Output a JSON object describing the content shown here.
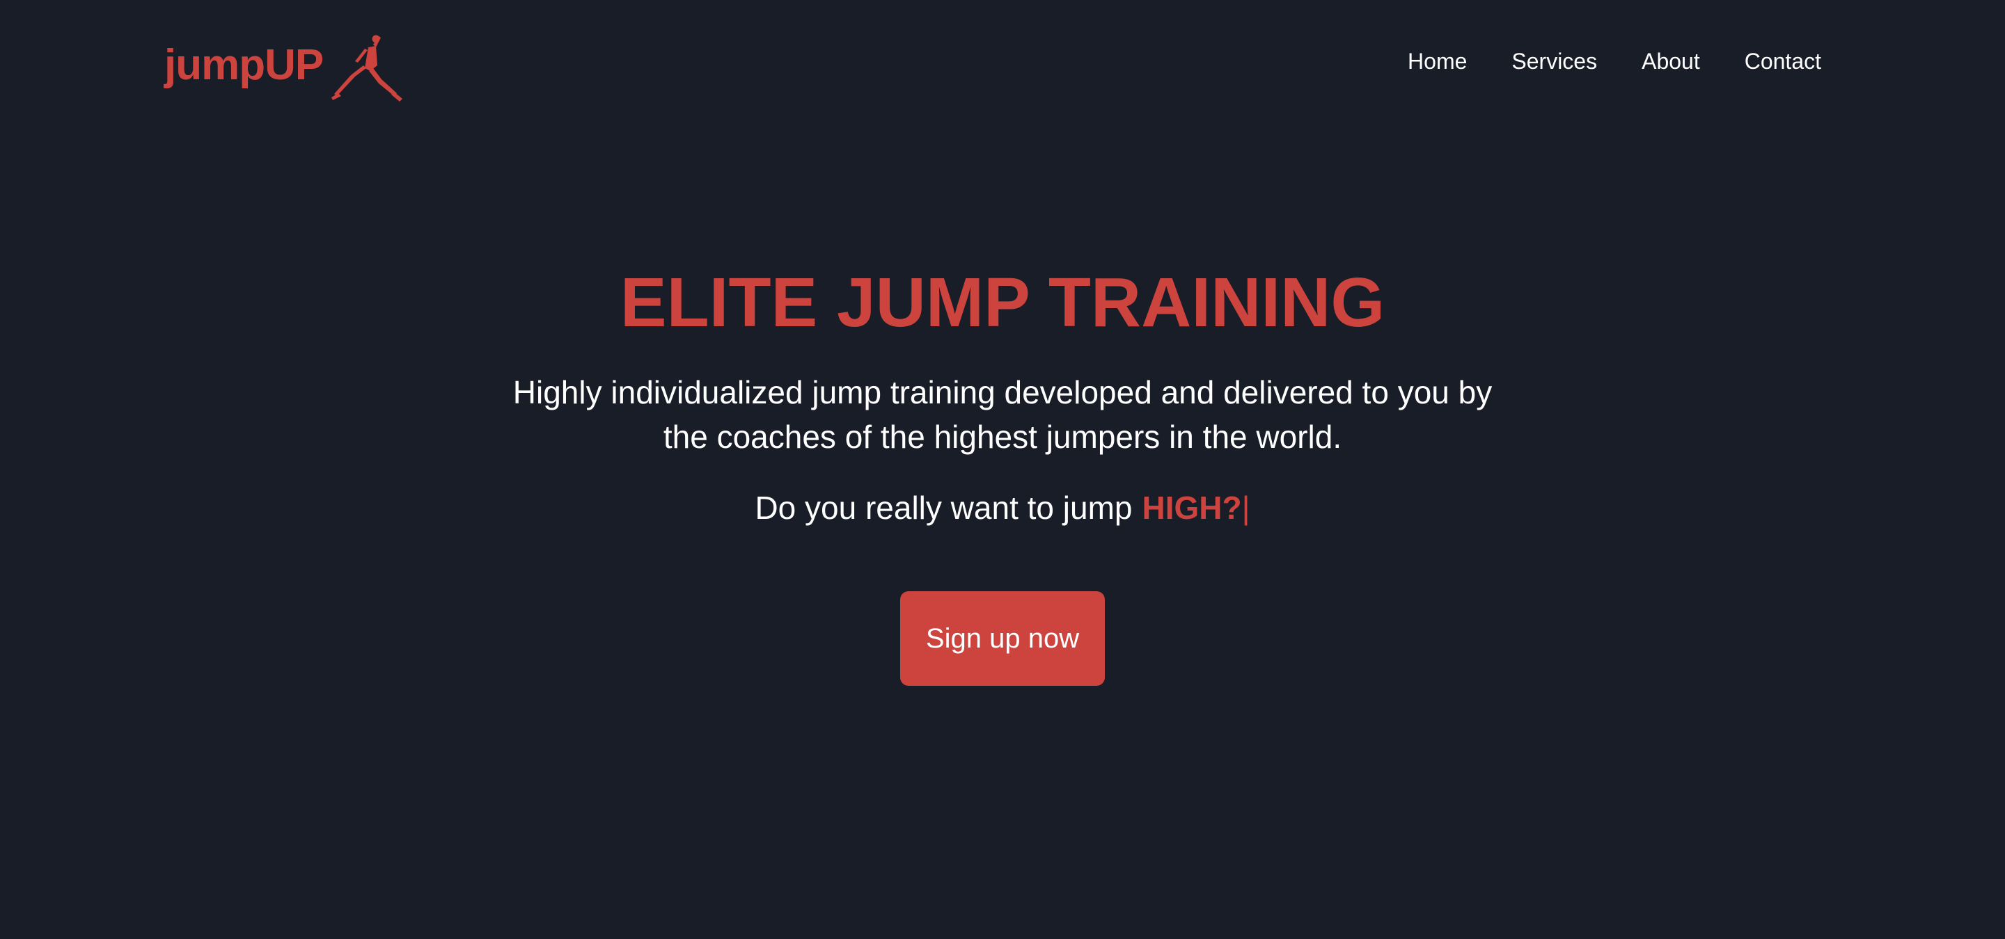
{
  "navbar": {
    "brand_text": "jumpUP",
    "brand_logo_icon": "jumpman-icon",
    "links": [
      "Home",
      "Services",
      "About",
      "Contact"
    ]
  },
  "hero": {
    "title": "ELITE JUMP TRAINING",
    "subtitle": "Highly individualized jump training developed and delivered to you by the coaches of the highest jumpers in the world.",
    "question_prefix": "Do you really want to jump",
    "question_highlight": "HIGH?",
    "cursor": "|",
    "cta_label": "Sign up now"
  },
  "colors": {
    "background": "#191d28",
    "accent": "#cd433e",
    "text": "#ffffff"
  }
}
